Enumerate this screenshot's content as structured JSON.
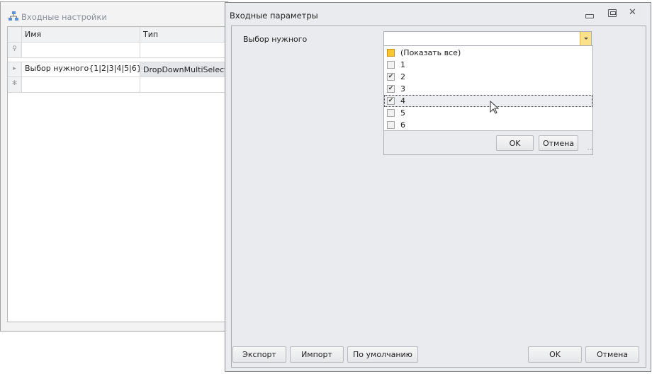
{
  "background_window": {
    "title": "Входные настройки",
    "grid": {
      "columns": [
        "Имя",
        "Тип"
      ],
      "rows": [
        {
          "name": "Выбор нужного{1|2|3|4|5|6}",
          "type": "DropDownMultiSelect"
        }
      ]
    }
  },
  "dialog": {
    "title": "Входные параметры",
    "field_label": "Выбор нужного",
    "combo_value": "",
    "dropdown": {
      "items": [
        {
          "label": "(Показать все)",
          "state": "partial"
        },
        {
          "label": "1",
          "state": "unchecked"
        },
        {
          "label": "2",
          "state": "checked"
        },
        {
          "label": "3",
          "state": "checked"
        },
        {
          "label": "4",
          "state": "checked",
          "focused": true
        },
        {
          "label": "5",
          "state": "unchecked"
        },
        {
          "label": "6",
          "state": "unchecked"
        }
      ],
      "ok": "OK",
      "cancel": "Отмена"
    },
    "buttons": {
      "export": "Экспорт",
      "import": "Импорт",
      "default": "По умолчанию",
      "ok": "OK",
      "cancel": "Отмена"
    }
  }
}
